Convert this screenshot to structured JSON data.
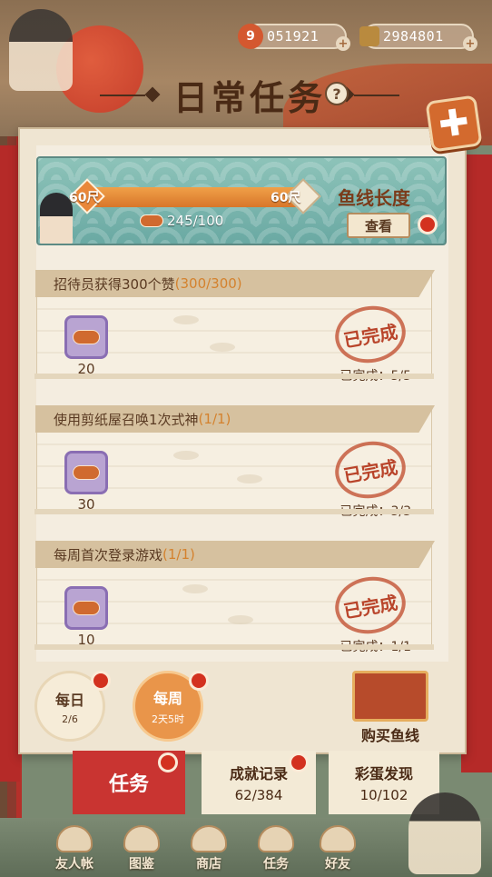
{
  "currency": {
    "magatama": "051921",
    "coins": "2984801"
  },
  "title": "日常任务",
  "help_symbol": "?",
  "close_symbol": "✚",
  "fishing_line": {
    "start_label": "60尺",
    "end_label": "60尺",
    "progress_fraction": 0.0,
    "bait_count": "245/100",
    "title": "鱼线长度",
    "view_button": "查看"
  },
  "tasks": [
    {
      "name": "招待员获得300个赞",
      "progress": "(300/300)",
      "reward": "20",
      "stamp": "已完成",
      "done": "已完成：5/5"
    },
    {
      "name": "使用剪纸屋召唤1次式神",
      "progress": "(1/1)",
      "reward": "30",
      "stamp": "已完成",
      "done": "已完成：3/3"
    },
    {
      "name": "每周首次登录游戏",
      "progress": "(1/1)",
      "reward": "10",
      "stamp": "已完成",
      "done": "已完成：1/1"
    }
  ],
  "periods": {
    "daily": {
      "name": "每日",
      "sub": "2/6"
    },
    "weekly": {
      "name": "每周",
      "sub": "2天5时"
    }
  },
  "buy_label": "购买鱼线",
  "bottom_tabs": {
    "task": "任务",
    "achievement": {
      "title": "成就记录",
      "count": "62/384"
    },
    "easter_egg": {
      "title": "彩蛋发现",
      "count": "10/102"
    }
  },
  "nav": [
    "友人帐",
    "图鉴",
    "商店",
    "任务",
    "好友"
  ],
  "colors": {
    "accent_red": "#c93431",
    "accent_orange": "#e9954a",
    "panel": "#efe5d2",
    "notify_dot": "#d3311f"
  }
}
